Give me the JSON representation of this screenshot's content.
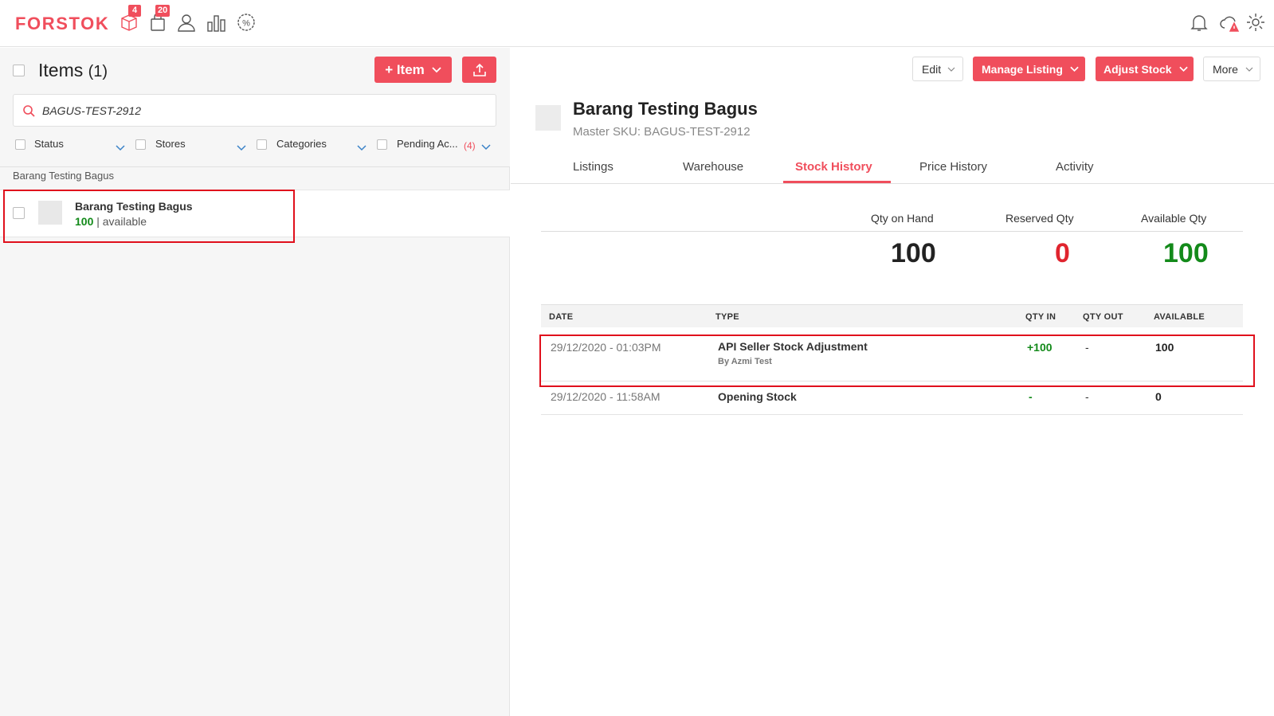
{
  "brand": {
    "name": "FORSTOK",
    "accent": "#f04e5c",
    "green": "#138a1a"
  },
  "nav": {
    "icons": [
      {
        "name": "box-icon",
        "badge": "4"
      },
      {
        "name": "shopping-bag-icon",
        "badge": "20"
      },
      {
        "name": "user-icon",
        "badge": ""
      },
      {
        "name": "bar-chart-icon",
        "badge": ""
      },
      {
        "name": "discount-icon",
        "badge": ""
      }
    ],
    "right_icons": [
      "bell-icon",
      "cloud-alert-icon",
      "gear-icon"
    ]
  },
  "left": {
    "title": "Items",
    "count": "(1)",
    "add_button": "+ Item",
    "search_value": "BAGUS-TEST-2912",
    "filters": {
      "status": "Status",
      "stores": "Stores",
      "categories": "Categories",
      "pending": "Pending Ac...",
      "pending_count": "(4)"
    },
    "group_label": "Barang Testing Bagus",
    "item": {
      "name": "Barang Testing Bagus",
      "qty": "100",
      "suffix": " | available"
    }
  },
  "right": {
    "buttons": {
      "edit": "Edit",
      "manage_listing": "Manage Listing",
      "adjust_stock": "Adjust Stock",
      "more": "More"
    },
    "title": "Barang Testing Bagus",
    "sku": "Master SKU: BAGUS-TEST-2912",
    "tabs": [
      "Listings",
      "Warehouse",
      "Stock History",
      "Price History",
      "Activity"
    ],
    "active_tab": "Stock History",
    "qty": {
      "on_hand_label": "Qty on Hand",
      "on_hand": "100",
      "reserved_label": "Reserved Qty",
      "reserved": "0",
      "available_label": "Available Qty",
      "available": "100"
    },
    "table": {
      "headers": {
        "date": "DATE",
        "type": "TYPE",
        "qty_in": "QTY IN",
        "qty_out": "QTY OUT",
        "available": "AVAILABLE"
      },
      "rows": [
        {
          "date": "29/12/2020 - 01:03PM",
          "type": "API Seller Stock Adjustment",
          "by": "By Azmi Test",
          "qty_in": "+100",
          "qty_out": "-",
          "available": "100"
        },
        {
          "date": "29/12/2020 - 11:58AM",
          "type": "Opening Stock",
          "by": "",
          "qty_in": "-",
          "qty_out": "-",
          "available": "0"
        }
      ]
    }
  }
}
